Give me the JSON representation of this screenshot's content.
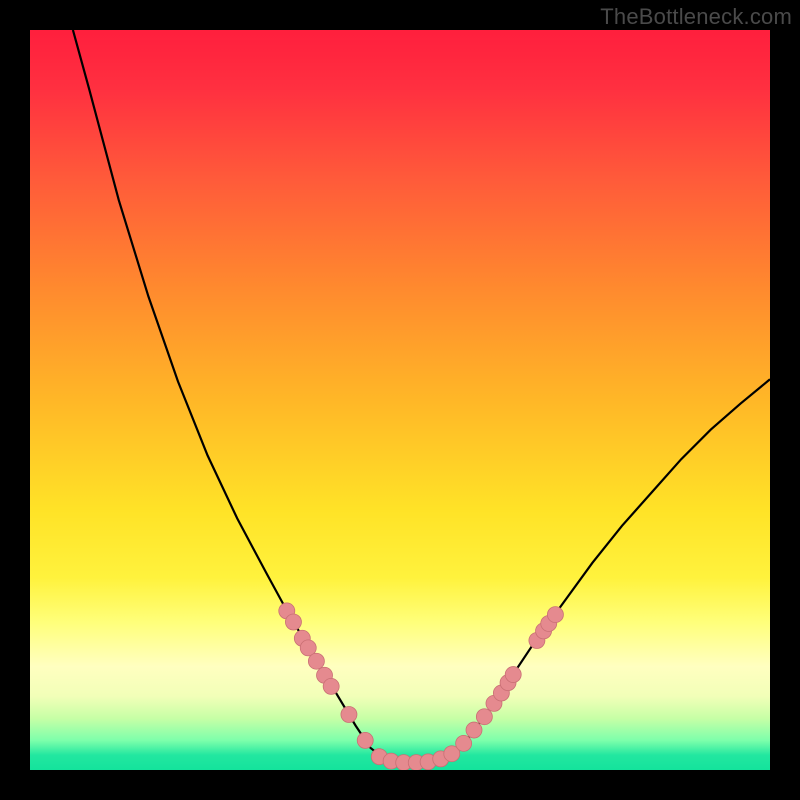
{
  "watermark": "TheBottleneck.com",
  "chart_data": {
    "type": "line",
    "title": "",
    "xlabel": "",
    "ylabel": "",
    "xlim": [
      0,
      100
    ],
    "ylim": [
      0,
      100
    ],
    "grid": false,
    "curve": [
      {
        "x": 5.8,
        "y": 100.0
      },
      {
        "x": 8.0,
        "y": 92.0
      },
      {
        "x": 12.0,
        "y": 77.0
      },
      {
        "x": 16.0,
        "y": 64.0
      },
      {
        "x": 20.0,
        "y": 52.5
      },
      {
        "x": 24.0,
        "y": 42.5
      },
      {
        "x": 28.0,
        "y": 34.0
      },
      {
        "x": 32.0,
        "y": 26.5
      },
      {
        "x": 35.0,
        "y": 21.0
      },
      {
        "x": 38.0,
        "y": 16.0
      },
      {
        "x": 41.0,
        "y": 11.0
      },
      {
        "x": 44.0,
        "y": 6.0
      },
      {
        "x": 46.0,
        "y": 3.0
      },
      {
        "x": 48.0,
        "y": 1.4
      },
      {
        "x": 50.0,
        "y": 1.0
      },
      {
        "x": 53.0,
        "y": 1.0
      },
      {
        "x": 56.0,
        "y": 1.6
      },
      {
        "x": 59.0,
        "y": 4.0
      },
      {
        "x": 62.0,
        "y": 8.0
      },
      {
        "x": 65.0,
        "y": 12.5
      },
      {
        "x": 68.0,
        "y": 17.0
      },
      {
        "x": 72.0,
        "y": 22.5
      },
      {
        "x": 76.0,
        "y": 28.0
      },
      {
        "x": 80.0,
        "y": 33.0
      },
      {
        "x": 84.0,
        "y": 37.5
      },
      {
        "x": 88.0,
        "y": 42.0
      },
      {
        "x": 92.0,
        "y": 46.0
      },
      {
        "x": 96.0,
        "y": 49.5
      },
      {
        "x": 100.0,
        "y": 52.8
      }
    ],
    "series": [
      {
        "name": "datapoints-left",
        "points": [
          {
            "x": 34.7,
            "y": 21.5
          },
          {
            "x": 35.6,
            "y": 20.0
          },
          {
            "x": 36.8,
            "y": 17.8
          },
          {
            "x": 37.6,
            "y": 16.5
          },
          {
            "x": 38.7,
            "y": 14.7
          },
          {
            "x": 39.8,
            "y": 12.8
          },
          {
            "x": 40.7,
            "y": 11.3
          },
          {
            "x": 43.1,
            "y": 7.5
          },
          {
            "x": 45.3,
            "y": 4.0
          }
        ]
      },
      {
        "name": "datapoints-trough",
        "points": [
          {
            "x": 47.2,
            "y": 1.8
          },
          {
            "x": 48.8,
            "y": 1.2
          },
          {
            "x": 50.5,
            "y": 1.0
          },
          {
            "x": 52.2,
            "y": 1.0
          },
          {
            "x": 53.8,
            "y": 1.1
          },
          {
            "x": 55.5,
            "y": 1.5
          },
          {
            "x": 57.0,
            "y": 2.2
          }
        ]
      },
      {
        "name": "datapoints-right",
        "points": [
          {
            "x": 58.6,
            "y": 3.6
          },
          {
            "x": 60.0,
            "y": 5.4
          },
          {
            "x": 61.4,
            "y": 7.2
          },
          {
            "x": 62.7,
            "y": 9.0
          },
          {
            "x": 63.7,
            "y": 10.4
          },
          {
            "x": 64.6,
            "y": 11.8
          },
          {
            "x": 65.3,
            "y": 12.9
          },
          {
            "x": 68.5,
            "y": 17.5
          },
          {
            "x": 69.4,
            "y": 18.8
          },
          {
            "x": 70.1,
            "y": 19.8
          },
          {
            "x": 71.0,
            "y": 21.0
          }
        ]
      }
    ]
  }
}
